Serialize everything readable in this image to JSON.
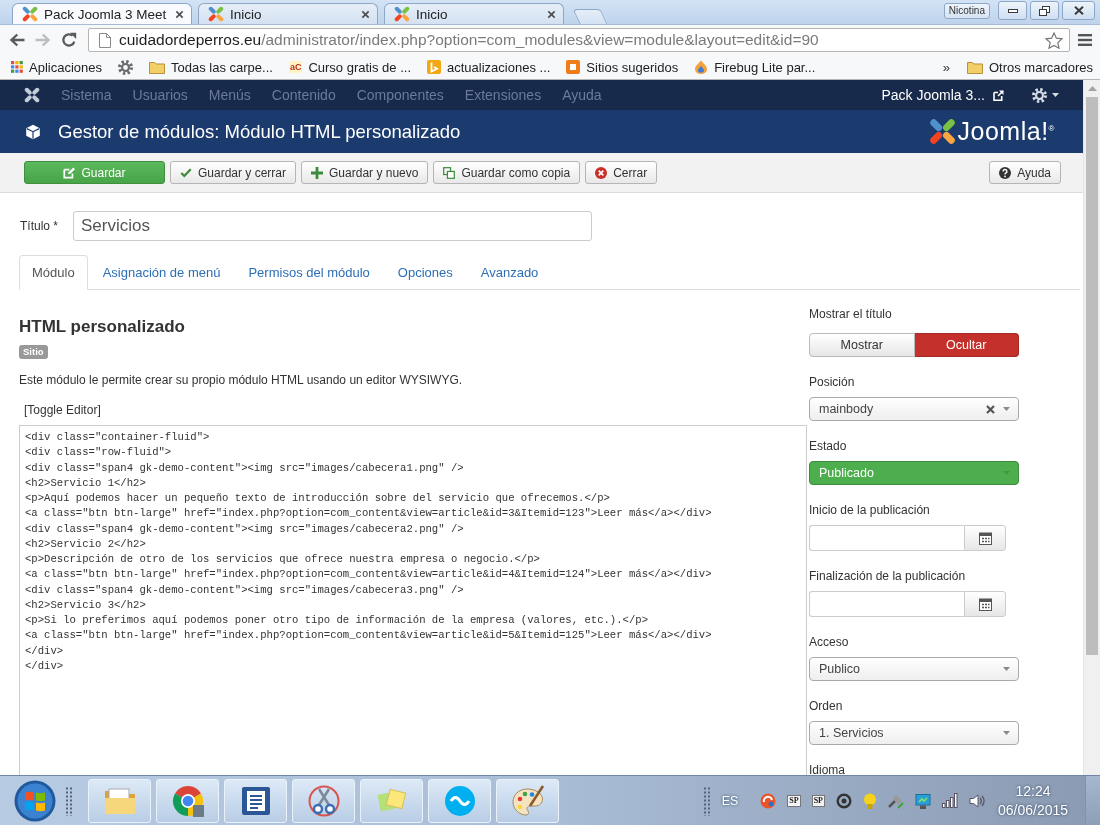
{
  "browser": {
    "tabs": [
      {
        "title": "Pack Joomla 3 Meet",
        "selected": true
      },
      {
        "title": "Inicio",
        "selected": false
      },
      {
        "title": "Inicio",
        "selected": false
      }
    ],
    "profile": "Nicotina",
    "nav_buttons": [
      {
        "kind": "back",
        "disabled": false
      },
      {
        "kind": "forward",
        "disabled": true
      },
      {
        "kind": "reload",
        "disabled": false
      }
    ],
    "address": {
      "host": "cuidadordeperros.eu",
      "path": "/administrator/index.php?option=com_modules&view=module&layout=edit&id=90"
    },
    "bookmarks": [
      {
        "kind": "apps",
        "label": "Aplicaciones"
      },
      {
        "kind": "gear"
      },
      {
        "kind": "folder",
        "label": "Todas las carpe..."
      },
      {
        "kind": "letters",
        "favicon_text": "aC",
        "label": "Curso gratis de ..."
      },
      {
        "kind": "tile",
        "label": "actualizaciones ..."
      },
      {
        "kind": "square",
        "label": "Sitios sugeridos"
      },
      {
        "kind": "flame",
        "label": "Firebug Lite par..."
      }
    ],
    "overflow": "»",
    "other_bookmarks": "Otros marcadores"
  },
  "admin": {
    "menu": [
      {
        "label": "Sistema",
        "disabled": true
      },
      {
        "label": "Usuarios",
        "disabled": true
      },
      {
        "label": "Menús",
        "disabled": true
      },
      {
        "label": "Contenido",
        "disabled": true
      },
      {
        "label": "Componentes",
        "disabled": true
      },
      {
        "label": "Extensiones",
        "disabled": true
      },
      {
        "label": "Ayuda",
        "disabled": true
      }
    ],
    "site_link": "Pack Joomla 3...",
    "page_title": "Gestor de módulos: Módulo HTML personalizado",
    "logo": "Joomla!$^{®}$"
  },
  "toolbar": {
    "buttons": [
      {
        "kind": "save",
        "label": "Guardar",
        "primary": true
      },
      {
        "kind": "saveclose",
        "label": "Guardar y cerrar",
        "primary": false
      },
      {
        "kind": "savenew",
        "label": "Guardar y nuevo",
        "primary": false
      },
      {
        "kind": "savecopy",
        "label": "Guardar como copia",
        "primary": false
      },
      {
        "kind": "close",
        "label": "Cerrar",
        "primary": false
      }
    ],
    "help": "Ayuda"
  },
  "form": {
    "title_label": "Título *",
    "title_value": "Servicios",
    "tabs": [
      {
        "label": "Módulo",
        "selected": true
      },
      {
        "label": "Asignación de menú",
        "selected": false
      },
      {
        "label": "Permisos del módulo",
        "selected": false
      },
      {
        "label": "Opciones",
        "selected": false
      },
      {
        "label": "Avanzado",
        "selected": false
      }
    ],
    "module": {
      "heading": "HTML personalizado",
      "badge": "Sitio",
      "description": "Este módulo le permite crear su propio módulo HTML usando un editor WYSIWYG.",
      "toggle_editor": "[Toggle Editor]",
      "code": [
        "<div class=\"container-fluid\">",
        "<div class=\"row-fluid\">",
        "<div class=\"span4 gk-demo-content\"><img src=\"images/cabecera1.png\" />",
        "<h2>Servicio 1</h2>",
        "<p>Aquí podemos hacer un pequeño texto de introducción sobre del servicio que ofrecemos.</p>",
        "<a class=\"btn btn-large\" href=\"index.php?option=com_content&view=article&id=3&Itemid=123\">Leer más</a></div>",
        "<div class=\"span4 gk-demo-content\"><img src=\"images/cabecera2.png\" />",
        "<h2>Servicio 2</h2>",
        "<p>Descripción de otro de los servicios que ofrece nuestra empresa o negocio.</p>",
        "<a class=\"btn btn-large\" href=\"index.php?option=com_content&view=article&id=4&Itemid=124\">Leer más</a></div>",
        "<div class=\"span4 gk-demo-content\"><img src=\"images/cabecera3.png\" />",
        "<h2>Servicio 3</h2>",
        "<p>Si lo preferimos aquí podemos poner otro tipo de información de la empresa (valores, etc.).</p>",
        "<a class=\"btn btn-large\" href=\"index.php?option=com_content&view=article&id=5&Itemid=125\">Leer más</a></div>",
        "</div>",
        "</div>"
      ]
    },
    "sidebar": [
      {
        "kind": "toggle",
        "label": "Mostrar el título",
        "options": [
          {
            "label": "Mostrar",
            "selected": false
          },
          {
            "label": "Ocultar",
            "selected": true
          }
        ]
      },
      {
        "kind": "select",
        "label": "Posición",
        "value": "mainbody",
        "clearable": true
      },
      {
        "kind": "status",
        "label": "Estado",
        "value": "Publicado"
      },
      {
        "kind": "date",
        "label": "Inicio de la publicación"
      },
      {
        "kind": "date",
        "label": "Finalización de la publicación"
      },
      {
        "kind": "select",
        "label": "Acceso",
        "value": "Publico",
        "clearable": false
      },
      {
        "kind": "select",
        "label": "Orden",
        "value": "1. Servicios",
        "clearable": false
      },
      {
        "kind": "label",
        "label": "Idioma"
      }
    ]
  },
  "taskbar": {
    "language": "ES",
    "tray_tiles": [
      "SP",
      "SP"
    ],
    "time": "12:24",
    "date": "06/06/2015"
  }
}
